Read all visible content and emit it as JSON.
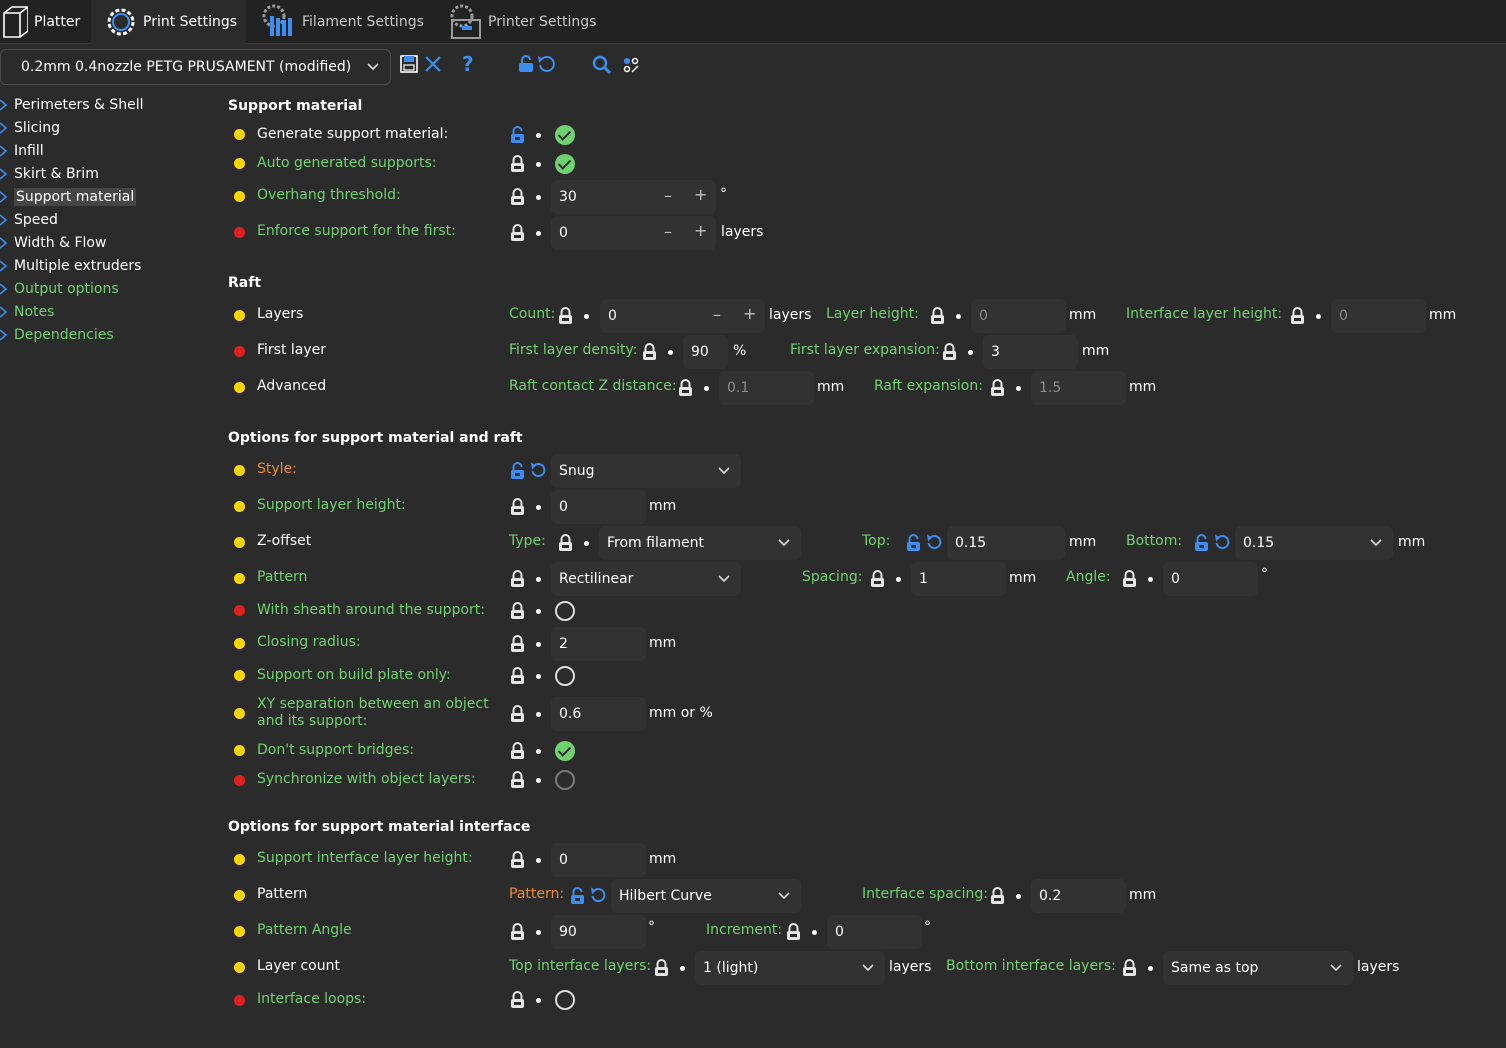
{
  "tabs": [
    {
      "label": "Platter",
      "icon": "cube-icon"
    },
    {
      "label": "Print Settings",
      "icon": "gear-icon"
    },
    {
      "label": "Filament Settings",
      "icon": "filament-icon"
    },
    {
      "label": "Printer Settings",
      "icon": "printer-icon"
    }
  ],
  "preset": {
    "value": "0.2mm 0.4nozzle PETG PRUSAMENT (modified)"
  },
  "toolbar": {
    "icons": [
      "save-icon",
      "delete-icon",
      "help-icon",
      "lock-icon",
      "undo-icon",
      "search-icon",
      "compare-icon"
    ],
    "help_glyph": "?"
  },
  "sidebar": [
    {
      "label": "Perimeters & Shell",
      "color": "#ffffff"
    },
    {
      "label": "Slicing",
      "color": "#ffffff"
    },
    {
      "label": "Infill",
      "color": "#ffffff"
    },
    {
      "label": "Skirt & Brim",
      "color": "#ffffff"
    },
    {
      "label": "Support material",
      "color": "#ffffff",
      "selected": true
    },
    {
      "label": "Speed",
      "color": "#ffffff"
    },
    {
      "label": "Width & Flow",
      "color": "#ffffff"
    },
    {
      "label": "Multiple extruders",
      "color": "#ffffff"
    },
    {
      "label": "Output options",
      "color": "#6ed36e"
    },
    {
      "label": "Notes",
      "color": "#6ed36e"
    },
    {
      "label": "Dependencies",
      "color": "#6ed36e"
    }
  ],
  "sections": {
    "support": "Support material",
    "raft": "Raft",
    "options": "Options for support material and raft",
    "interface": "Options for support material interface"
  },
  "labels": {
    "generate": "Generate support material:",
    "auto": "Auto generated supports:",
    "overhang": "Overhang threshold:",
    "enforce": "Enforce support for the first:",
    "layers": "Layers",
    "first_layer": "First layer",
    "advanced": "Advanced",
    "count": "Count:",
    "layer_height": "Layer height:",
    "interface_layer_height": "Interface layer height:",
    "first_layer_density": "First layer density:",
    "first_layer_expansion": "First layer expansion:",
    "raft_contact_z": "Raft contact Z distance:",
    "raft_expansion": "Raft expansion:",
    "style": "Style:",
    "support_layer_height": "Support layer height:",
    "zoffset": "Z-offset",
    "type": "Type:",
    "top": "Top:",
    "bottom": "Bottom:",
    "pattern": "Pattern",
    "spacing": "Spacing:",
    "angle": "Angle:",
    "sheath": "With sheath around the support:",
    "closing_radius": "Closing radius:",
    "build_plate_only": "Support on build plate only:",
    "xy_sep_1": "XY separation between an object",
    "xy_sep_2": "and its support:",
    "dont_bridges": "Don't support bridges:",
    "sync_layers": "Synchronize with object layers:",
    "support_interface_height": "Support interface layer height:",
    "pattern2": "Pattern",
    "pattern_colon": "Pattern:",
    "interface_spacing": "Interface spacing:",
    "pattern_angle": "Pattern Angle",
    "increment": "Increment:",
    "layer_count": "Layer count",
    "top_interface_layers": "Top interface layers:",
    "bottom_interface_layers": "Bottom interface layers:",
    "interface_loops": "Interface loops:"
  },
  "values": {
    "overhang": "30",
    "enforce": "0",
    "raft_count": "0",
    "raft_layer_height": "0",
    "raft_interface_layer_height": "0",
    "first_layer_density": "90",
    "first_layer_expansion": "3",
    "raft_contact_z": "0.1",
    "raft_expansion": "1.5",
    "style": "Snug",
    "support_layer_height": "0",
    "zoffset_type": "From filament",
    "zoffset_top": "0.15",
    "zoffset_bottom": "0.15",
    "pattern": "Rectilinear",
    "spacing": "1",
    "angle": "0",
    "closing_radius": "2",
    "xy_sep": "0.6",
    "interface_height": "0",
    "interface_pattern": "Hilbert Curve",
    "interface_spacing": "0.2",
    "pattern_angle": "90",
    "increment": "0",
    "top_interface_layers": "1 (light)",
    "bottom_interface_layers": "Same as top"
  },
  "units": {
    "deg": "°",
    "layers": "layers",
    "mm": "mm",
    "pct": "%",
    "mm_or_pct": "mm or %"
  },
  "glyphs": {
    "minus": "–",
    "plus": "+"
  },
  "colors": {
    "bg": "#2b2b2b",
    "field": "#323232",
    "green": "#6ed36e",
    "orange": "#f08a24",
    "yellow": "#ffd500",
    "red": "#e02020",
    "blue": "#3b8df0"
  }
}
